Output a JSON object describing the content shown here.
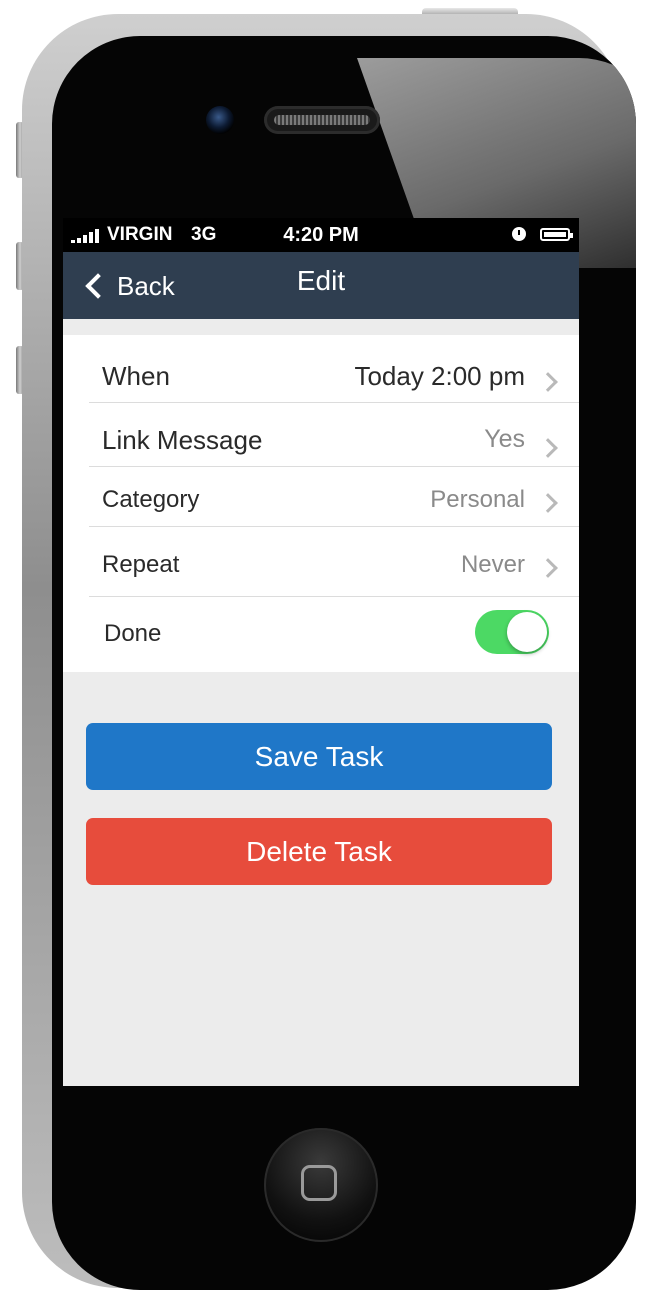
{
  "status_bar": {
    "carrier": "VIRGIN",
    "network": "3G",
    "time": "4:20 PM"
  },
  "nav": {
    "back_label": "Back",
    "title": "Edit",
    "background_color": "#2f3e50"
  },
  "rows": [
    {
      "label": "When",
      "value": "Today 2:00 pm"
    },
    {
      "label": "Link Message",
      "value": "Yes"
    },
    {
      "label": "Category",
      "value": "Personal"
    },
    {
      "label": "Repeat",
      "value": "Never"
    },
    {
      "label": "Done",
      "toggle_on": true
    }
  ],
  "buttons": {
    "save_label": "Save Task",
    "save_color": "#1f77c8",
    "delete_label": "Delete Task",
    "delete_color": "#e74c3c"
  },
  "toggle_color": "#4cd964",
  "icons": [
    "signal-icon",
    "alarm-icon",
    "battery-icon",
    "back-chevron-icon",
    "chevron-right-icon",
    "home-button-icon"
  ]
}
